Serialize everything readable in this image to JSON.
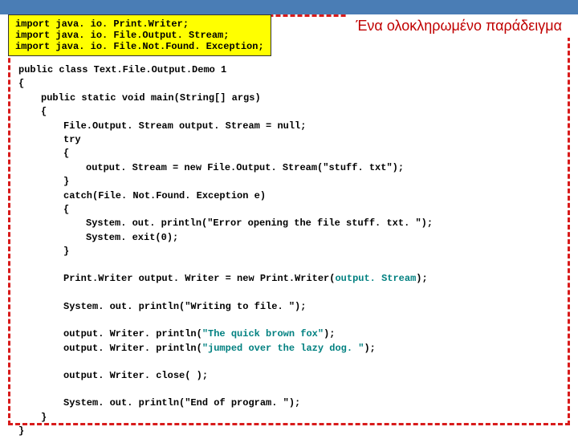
{
  "title": "Ένα ολοκληρωμένο παράδειγμα",
  "imports": {
    "l1": "import java. io. Print.Writer;",
    "l2": "import java. io. File.Output. Stream;",
    "l3": "import java. io. File.Not.Found. Exception;"
  },
  "code": {
    "c01": "public class Text.File.Output.Demo 1",
    "c02": "{",
    "c03": "public static void main(String[] args)",
    "c04": "{",
    "c05": "File.Output. Stream output. Stream = null;",
    "c06": "try",
    "c07": "{",
    "c08": "output. Stream = new File.Output. Stream(\"stuff. txt\");",
    "c09": "}",
    "c10": "catch(File. Not.Found. Exception e)",
    "c11": "{",
    "c12": "System. out. println(\"Error opening the file stuff. txt. \");",
    "c13": "System. exit(0);",
    "c14": "}",
    "c15a": "Print.Writer output. Writer = new Print.Writer(",
    "c15b": "output. Stream",
    "c15c": ");",
    "c16": "System. out. println(\"Writing to file. \");",
    "c17a": "output. Writer. println(",
    "c17b": "\"The quick brown fox\"",
    "c17c": ");",
    "c18a": "output. Writer. println(",
    "c18b": "\"jumped over the lazy dog. \"",
    "c18c": ");",
    "c19": "output. Writer. close( );",
    "c20": "System. out. println(\"End of program. \");",
    "c21": "}",
    "c22": "}"
  }
}
